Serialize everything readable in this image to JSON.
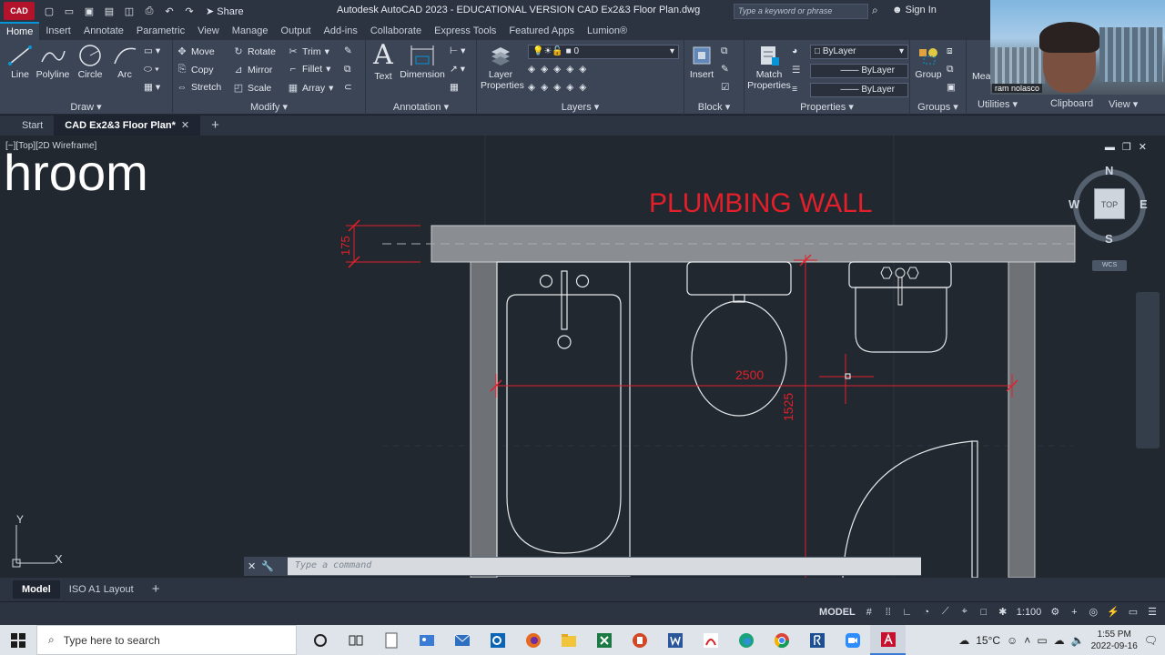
{
  "titlebar": {
    "app_badge": "CAD",
    "share_label": "Share",
    "title": "Autodesk AutoCAD 2023 - EDUCATIONAL VERSION    CAD Ex2&3 Floor Plan.dwg",
    "search_placeholder": "Type a keyword or phrase",
    "signin": "Sign In"
  },
  "ribbon_tabs": [
    "Home",
    "Insert",
    "Annotate",
    "Parametric",
    "View",
    "Manage",
    "Output",
    "Add-ins",
    "Collaborate",
    "Express Tools",
    "Featured Apps",
    "Lumion®"
  ],
  "ribbon": {
    "draw": {
      "title": "Draw",
      "line": "Line",
      "polyline": "Polyline",
      "circle": "Circle",
      "arc": "Arc"
    },
    "modify": {
      "title": "Modify",
      "move": "Move",
      "rotate": "Rotate",
      "trim": "Trim",
      "copy": "Copy",
      "mirror": "Mirror",
      "fillet": "Fillet",
      "stretch": "Stretch",
      "scale": "Scale",
      "array": "Array"
    },
    "annotation": {
      "title": "Annotation",
      "text": "Text",
      "dimension": "Dimension"
    },
    "layers": {
      "title": "Layers",
      "layer_properties": "Layer Properties",
      "current_layer": "0"
    },
    "block": {
      "title": "Block",
      "insert": "Insert"
    },
    "properties": {
      "title": "Properties",
      "match_properties": "Match Properties",
      "color": "ByLayer",
      "linetype": "ByLayer",
      "lineweight": "ByLayer"
    },
    "groups": {
      "title": "Groups",
      "group": "Group"
    },
    "utilities": {
      "title": "Utilities",
      "measure": "Mea"
    },
    "clipboard": {
      "title": "Clipboard"
    },
    "view": {
      "title": "View"
    }
  },
  "webcam": {
    "name": "ram nolasco"
  },
  "file_tabs": {
    "start": "Start",
    "active": "CAD Ex2&3 Floor Plan*"
  },
  "viewport": {
    "label": "[−][Top][2D Wireframe]",
    "overlay_text": "hroom",
    "viewcube": {
      "n": "N",
      "s": "S",
      "e": "E",
      "w": "W",
      "top": "TOP",
      "wcs": "WCS"
    }
  },
  "drawing": {
    "wall_label": "PLUMBING WALL",
    "dim_width": "2500",
    "dim_depth": "1525",
    "dim_wall": "175",
    "ucs_y": "Y",
    "ucs_x": "X"
  },
  "colors": {
    "accent": "#0696d7",
    "dimension": "#e3202a",
    "canvas": "#212830",
    "ribbon": "#3b4556"
  },
  "command_line": {
    "placeholder": "Type a command"
  },
  "layout_tabs": [
    "Model",
    "ISO A1 Layout"
  ],
  "statusbar": {
    "model": "MODEL",
    "scale": "1:100"
  },
  "taskbar": {
    "search_placeholder": "Type here to search",
    "temperature": "15°C",
    "time": "1:55 PM",
    "date": "2022-09-16"
  }
}
